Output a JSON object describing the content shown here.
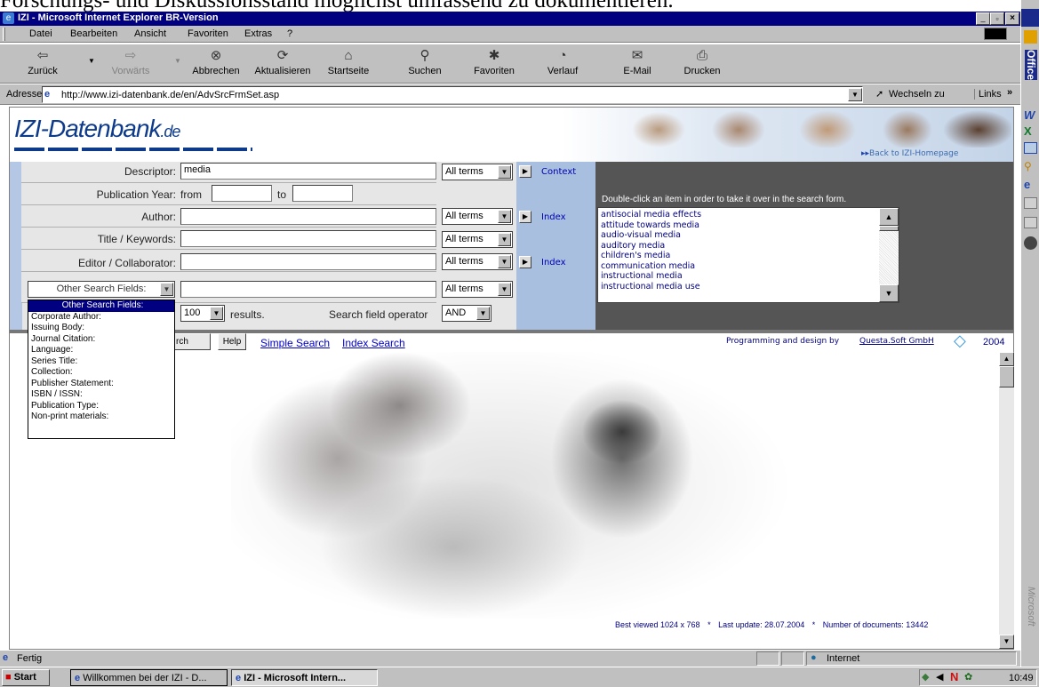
{
  "overlay_text": "Forschungs- und Diskussionsstand möglichst umfassend zu dokumentieren.",
  "window": {
    "title": "IZI - Microsoft Internet Explorer BR-Version"
  },
  "menu": [
    "Datei",
    "Bearbeiten",
    "Ansicht",
    "Favoriten",
    "Extras",
    "?"
  ],
  "toolbar": {
    "back": "Zurück",
    "forward": "Vorwärts",
    "stop": "Abbrechen",
    "refresh": "Aktualisieren",
    "home": "Startseite",
    "search": "Suchen",
    "favorites": "Favoriten",
    "history": "Verlauf",
    "mail": "E-Mail",
    "print": "Drucken"
  },
  "address": {
    "label": "Adresse",
    "url": "http://www.izi-datenbank.de/en/AdvSrcFrmSet.asp",
    "go": "Wechseln zu",
    "links": "Links"
  },
  "office_bar": {
    "title": "Office",
    "bottom": "Microsoft"
  },
  "site": {
    "logo_main": "IZI-Datenbank",
    "logo_suffix": ".de",
    "back_link": "Back to IZI-Homepage"
  },
  "form": {
    "descriptor_label": "Descriptor:",
    "descriptor_value": "media",
    "pubyear_label": "Publication Year:",
    "from_label": "from",
    "to_label": "to",
    "author_label": "Author:",
    "title_label": "Title / Keywords:",
    "editor_label": "Editor / Collaborator:",
    "other_fields_select": "Other Search Fields:",
    "all_terms": "All terms",
    "context_label": "Context",
    "index_label": "Index",
    "results_value": "100",
    "results_label": "results.",
    "operator_label": "Search field operator",
    "operator_value": "AND"
  },
  "dropdown_options": [
    "Other Search Fields:",
    "Corporate Author:",
    "Issuing Body:",
    "Journal Citation:",
    "Language:",
    "Series Title:",
    "Collection:",
    "Publisher Statement:",
    "ISBN / ISSN:",
    "Publication Type:",
    "Non-print materials:"
  ],
  "context_panel": {
    "hint": "Double-click an item in order to take it over in the search form.",
    "items": [
      "antisocial media effects",
      "attitude towards media",
      "audio-visual media",
      "auditory media",
      "children's media",
      "communication media",
      "instructional media",
      "instructional media use"
    ]
  },
  "actions": {
    "search": "rch",
    "help": "Help",
    "simple": "Simple Search",
    "index": "Index Search"
  },
  "credit": {
    "text": "Programming and design by",
    "link": "Questa.Soft GmbH",
    "year": "2004"
  },
  "footer": {
    "best_viewed": "Best viewed 1024 x 768",
    "last_update": "Last update: 28.07.2004",
    "docs": "Number of documents: 13442",
    "sep": "*"
  },
  "status": {
    "text": "Fertig",
    "zone": "Internet"
  },
  "taskbar": {
    "start": "Start",
    "task1": "Willkommen bei der IZI - D...",
    "task2": "IZI - Microsoft Intern...",
    "clock": "10:49"
  }
}
